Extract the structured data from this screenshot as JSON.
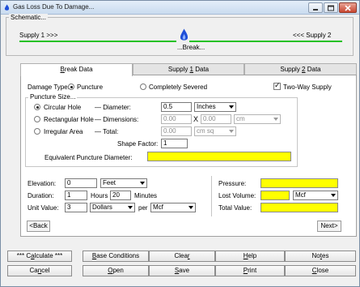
{
  "window": {
    "title": "Gas Loss Due To Damage...",
    "icons": [
      "app-flame-icon",
      "minimize-icon",
      "maximize-icon",
      "close-icon"
    ]
  },
  "schematic": {
    "legend": "Schematic...",
    "supply1_label": "Supply 1 >>>",
    "supply2_label": "<<< Supply 2",
    "break_label": "...Break...",
    "pipe_color": "#26c126",
    "flame_color": "#1f4fd8"
  },
  "tabs": [
    {
      "pre": "",
      "key": "B",
      "post": "reak Data",
      "active": true
    },
    {
      "pre": "Supply ",
      "key": "1",
      "post": " Data",
      "active": false
    },
    {
      "pre": "Supply ",
      "key": "2",
      "post": " Data",
      "active": false
    }
  ],
  "damage": {
    "type_label": "Damage Type:",
    "puncture_label": "Puncture",
    "severed_label": "Completely Severed",
    "two_way_label": "Two-Way Supply",
    "two_way_checked": true,
    "puncture_checked": true
  },
  "puncture": {
    "legend": "Puncture Size...",
    "circular_label": "Circular Hole",
    "rectangular_label": "Rectangular Hole",
    "irregular_label": "Irregular Area",
    "diameter_label": "— Diameter:",
    "dimensions_label": "— Dimensions:",
    "total_label": "— Total:",
    "shape_factor_label": "Shape Factor:",
    "diameter_value": "0.5",
    "diameter_unit": "Inches",
    "dim1_value": "0.00",
    "times_symbol": "X",
    "dim2_value": "0.00",
    "dim_unit": "cm",
    "total_value": "0.00",
    "total_unit": "cm sq",
    "shape_factor_value": "1",
    "equiv_label": "Equivalent Puncture Diameter:",
    "equiv_value": ""
  },
  "params": {
    "elevation_label": "Elevation:",
    "elevation_value": "0",
    "elevation_unit": "Feet",
    "duration_label": "Duration:",
    "duration_hours_value": "1",
    "hours_label": "Hours",
    "duration_minutes_value": "20",
    "minutes_label": "Minutes",
    "unit_value_label": "Unit Value:",
    "unit_value": "3",
    "currency_unit": "Dollars",
    "per_label": "per",
    "per_unit": "Mcf"
  },
  "results": {
    "pressure_label": "Pressure:",
    "pressure_value": "",
    "lost_volume_label": "Lost Volume:",
    "lost_volume_value": "",
    "lost_volume_unit": "Mcf",
    "total_value_label": "Total Value:",
    "total_value": ""
  },
  "nav": {
    "back_label": "<Back",
    "next_label": "Next>"
  },
  "buttons": {
    "calculate": {
      "pre": "*** C",
      "key": "a",
      "post": "lculate ***"
    },
    "base_conditions": {
      "pre": "",
      "key": "B",
      "post": "ase Conditions"
    },
    "clear": {
      "pre": "Clea",
      "key": "r",
      "post": ""
    },
    "help": {
      "pre": "",
      "key": "H",
      "post": "elp"
    },
    "notes": {
      "pre": "No",
      "key": "t",
      "post": "es"
    },
    "cancel": {
      "pre": "Ca",
      "key": "n",
      "post": "cel"
    },
    "open": {
      "pre": "",
      "key": "O",
      "post": "pen"
    },
    "save": {
      "pre": "",
      "key": "S",
      "post": "ave"
    },
    "print": {
      "pre": "",
      "key": "P",
      "post": "rint"
    },
    "close": {
      "pre": "",
      "key": "C",
      "post": "lose"
    }
  },
  "colors": {
    "highlight_field": "#ffff00",
    "window_bg": "#f0f0f0"
  }
}
